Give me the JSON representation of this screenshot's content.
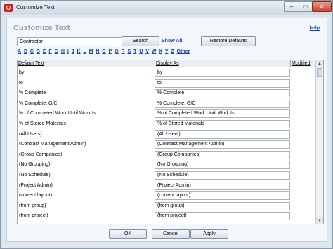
{
  "window": {
    "title": "Customize Text"
  },
  "header": {
    "title": "Customize Text",
    "help_label": "help"
  },
  "search": {
    "value": "Contractor",
    "button_label": "Search",
    "show_all_label": "Show All",
    "restore_label": "Restore Defaults"
  },
  "alphabet": [
    "A",
    "B",
    "C",
    "D",
    "E",
    "F",
    "G",
    "H",
    "I",
    "J",
    "K",
    "L",
    "M",
    "N",
    "O",
    "P",
    "Q",
    "R",
    "S",
    "T",
    "U",
    "V",
    "W",
    "X",
    "Y",
    "Z",
    "Other"
  ],
  "table": {
    "columns": {
      "default_text": "Default Text",
      "display_as": "Display As",
      "modified": "Modified"
    },
    "rows": [
      {
        "default": "by",
        "display": "by"
      },
      {
        "default": "to",
        "display": "to"
      },
      {
        "default": "% Complete",
        "display": "% Complete"
      },
      {
        "default": "% Complete, G/C",
        "display": "% Complete, G/C"
      },
      {
        "default": "% of Completed Work Until Work Is:",
        "display": "% of Completed Work Until Work Is:"
      },
      {
        "default": "% of Stored Materials",
        "display": "% of Stored Materials"
      },
      {
        "default": "(All Users)",
        "display": "(All Users)"
      },
      {
        "default": "(Contract Management Admin)",
        "display": "(Contract Management Admin)"
      },
      {
        "default": "(Group Companies)",
        "display": "(Group Companies)"
      },
      {
        "default": "(No Grouping)",
        "display": "(No Grouping)"
      },
      {
        "default": "(No Schedule)",
        "display": "(No Schedule)"
      },
      {
        "default": "(Project Admin)",
        "display": "(Project Admin)"
      },
      {
        "default": "(current layout)",
        "display": "(current layout)"
      },
      {
        "default": "(from group)",
        "display": "(from group)"
      },
      {
        "default": "(from project)",
        "display": "(from project)"
      }
    ]
  },
  "footer": {
    "ok_label": "OK",
    "cancel_label": "Cancel",
    "apply_label": "Apply"
  },
  "colors": {
    "link": "#1a3fbf",
    "heading": "#8fa3b5",
    "close_button": "#c9412e"
  }
}
